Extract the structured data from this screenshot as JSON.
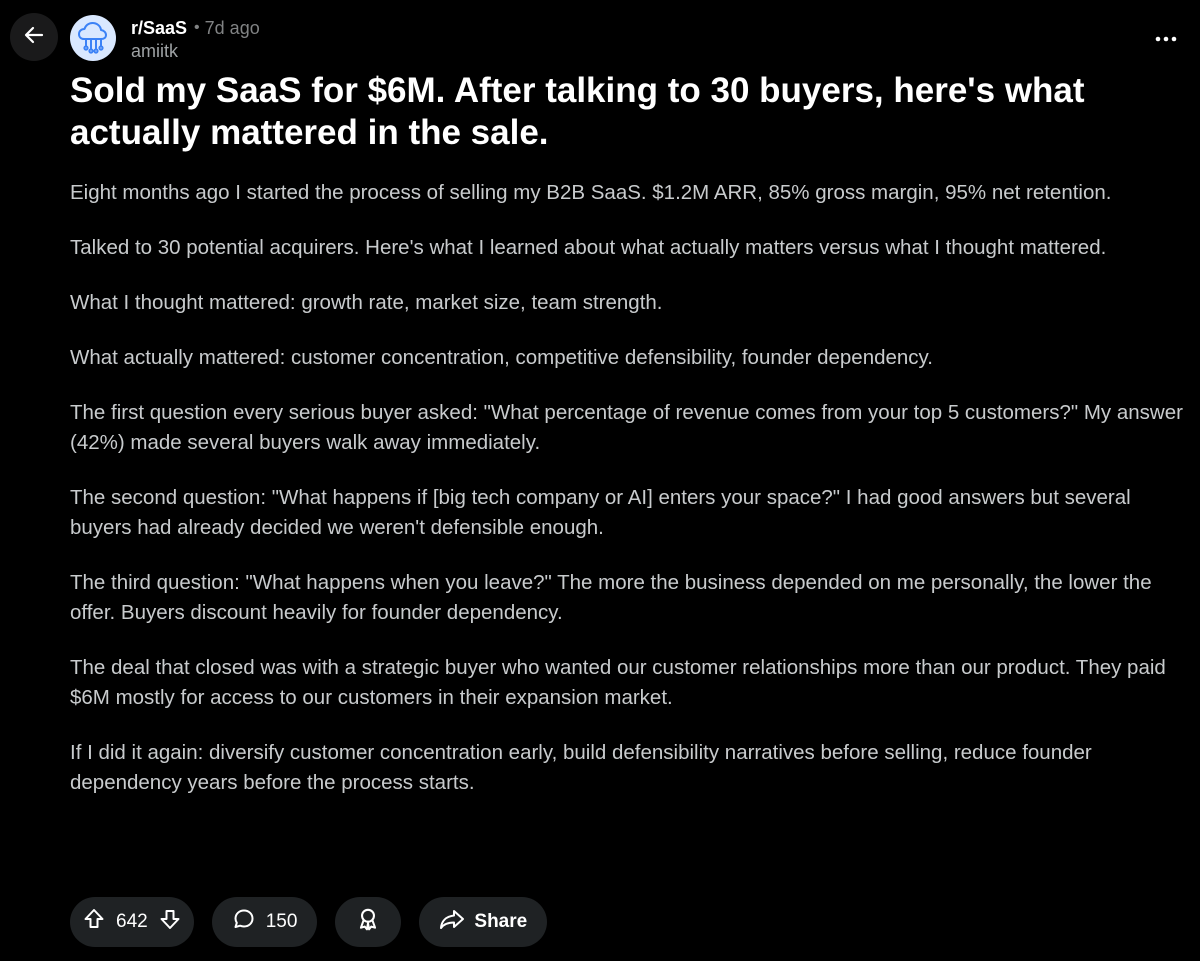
{
  "header": {
    "subreddit": "r/SaaS",
    "separator": "•",
    "time_ago": "7d ago",
    "author": "amiitk"
  },
  "post": {
    "title": "Sold my SaaS for $6M. After talking to 30 buyers, here's what actually mattered in the sale.",
    "paragraphs": [
      "Eight months ago I started the process of selling my B2B SaaS. $1.2M ARR, 85% gross margin, 95% net retention.",
      "Talked to 30 potential acquirers. Here's what I learned about what actually matters versus what I thought mattered.",
      "What I thought mattered: growth rate, market size, team strength.",
      "What actually mattered: customer concentration, competitive defensibility, founder dependency.",
      "The first question every serious buyer asked: \"What percentage of revenue comes from your top 5 customers?\" My answer (42%) made several buyers walk away immediately.",
      "The second question: \"What happens if [big tech company or AI] enters your space?\" I had good answers but several buyers had already decided we weren't defensible enough.",
      "The third question: \"What happens when you leave?\" The more the business depended on me personally, the lower the offer. Buyers discount heavily for founder dependency.",
      "The deal that closed was with a strategic buyer who wanted our customer relationships more than our product. They paid $6M mostly for access to our customers in their expansion market.",
      "If I did it again: diversify customer concentration early, build defensibility narratives before selling, reduce founder dependency years before the process starts."
    ]
  },
  "actions": {
    "votes": "642",
    "comments": "150",
    "share_label": "Share"
  },
  "icons": {
    "back": "arrow-left-icon",
    "avatar": "cloud-network-icon",
    "more": "more-horizontal-icon",
    "upvote": "upvote-arrow-icon",
    "downvote": "downvote-arrow-icon",
    "comment": "comment-bubble-icon",
    "award": "award-icon",
    "share": "share-arrow-icon"
  },
  "colors": {
    "background": "#000000",
    "pill": "#1f2224",
    "title": "#ffffff",
    "body_text": "#c8cbcd",
    "muted": "#818384",
    "avatar_bg": "#d9e8ff",
    "avatar_accent": "#3b82f6"
  }
}
